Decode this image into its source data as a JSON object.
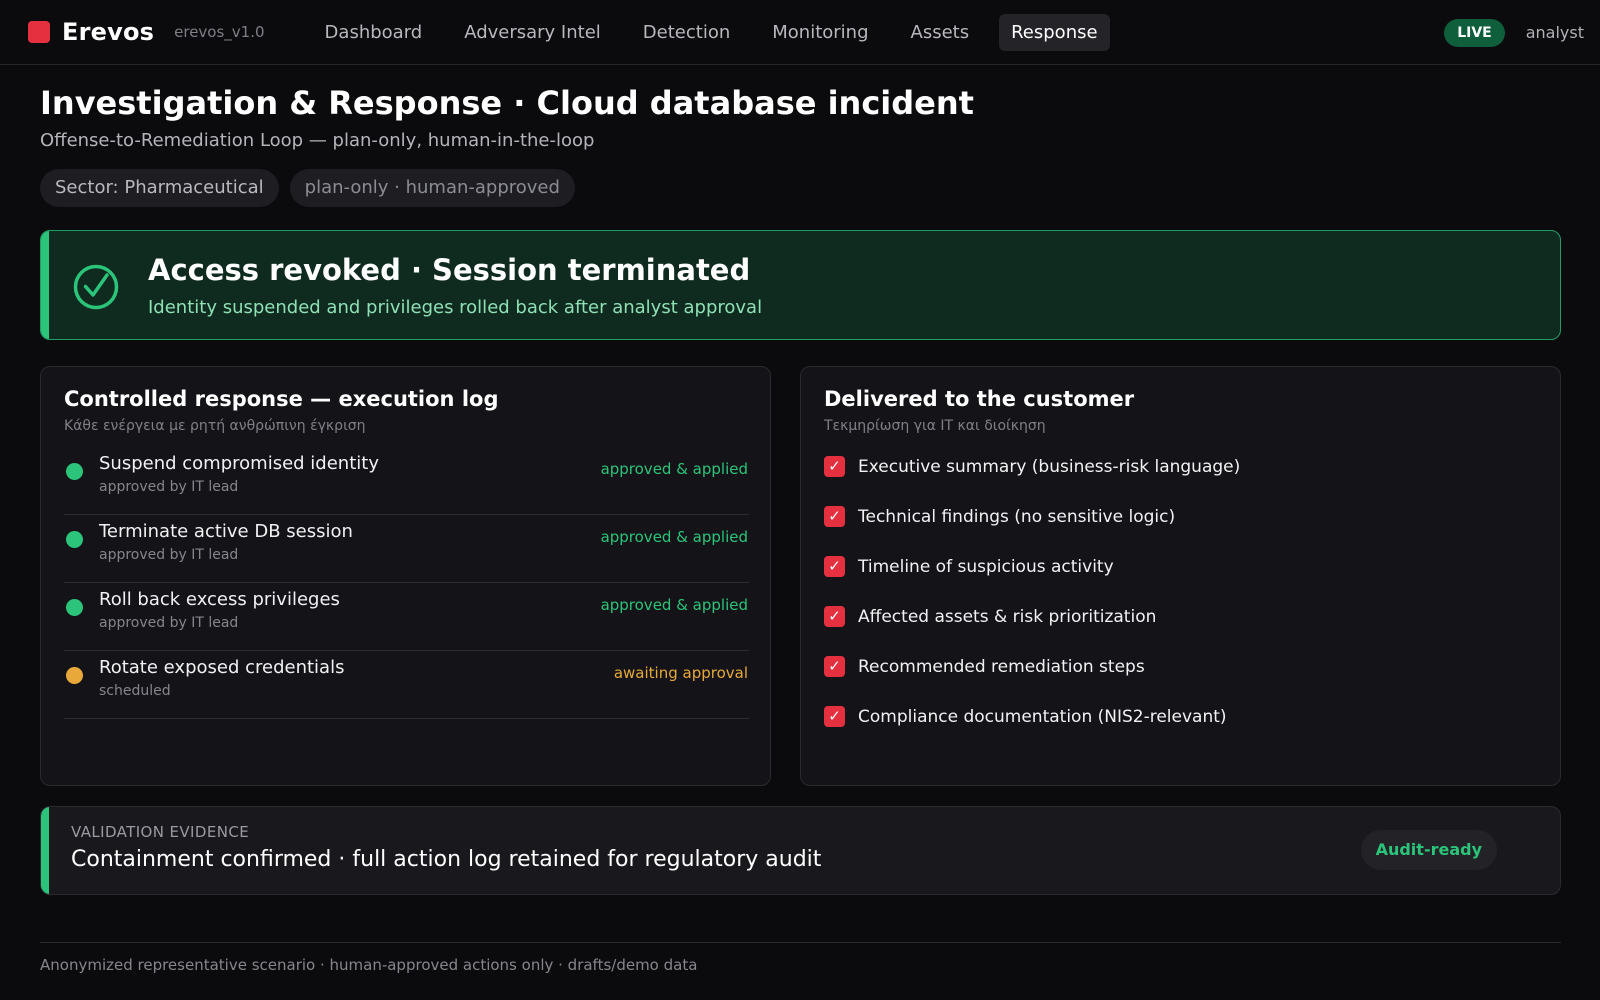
{
  "app": {
    "name": "Erevos",
    "version": "erevos_v1.0",
    "brand_color": "#e5303f"
  },
  "nav": {
    "items": [
      {
        "label": "Dashboard",
        "active": false
      },
      {
        "label": "Adversary Intel",
        "active": false
      },
      {
        "label": "Detection",
        "active": false
      },
      {
        "label": "Monitoring",
        "active": false
      },
      {
        "label": "Assets",
        "active": false
      },
      {
        "label": "Response",
        "active": true
      }
    ]
  },
  "status": {
    "live_label": "LIVE",
    "user": "analyst"
  },
  "header": {
    "title": "Investigation & Response · Cloud database incident",
    "subtitle": "Offense-to-Remediation Loop — plan-only, human-in-the-loop",
    "chips": [
      "Sector: Pharmaceutical",
      "plan-only · human-approved"
    ]
  },
  "banner": {
    "icon": "check-circle-icon",
    "title": "Access revoked · Session terminated",
    "subtitle": "Identity suspended and privileges rolled back after analyst approval",
    "color": "#2bc47a"
  },
  "execution_log": {
    "title": "Controlled response — execution log",
    "subtitle": "Κάθε ενέργεια με ρητή ανθρώπινη έγκριση",
    "items": [
      {
        "name": "Suspend compromised identity",
        "meta": "approved by IT lead",
        "status": "approved & applied",
        "state": "done"
      },
      {
        "name": "Terminate active DB session",
        "meta": "approved by IT lead",
        "status": "approved & applied",
        "state": "done"
      },
      {
        "name": "Roll back excess privileges",
        "meta": "approved by IT lead",
        "status": "approved & applied",
        "state": "done"
      },
      {
        "name": "Rotate exposed credentials",
        "meta": "scheduled",
        "status": "awaiting approval",
        "state": "pending"
      }
    ],
    "colors": {
      "done": "#2bc47a",
      "pending": "#e8a93a"
    }
  },
  "deliverables": {
    "title": "Delivered to the customer",
    "subtitle": "Τεκμηρίωση για IT και διοίκηση",
    "items": [
      "Executive summary (business-risk language)",
      "Technical findings (no sensitive logic)",
      "Timeline of suspicious activity",
      "Affected assets & risk prioritization",
      "Recommended remediation steps",
      "Compliance documentation (NIS2-relevant)"
    ]
  },
  "validation": {
    "label": "VALIDATION EVIDENCE",
    "text": "Containment confirmed · full action log retained for regulatory audit",
    "badge": "Audit-ready"
  },
  "footer": {
    "text": "Anonymized representative scenario · human-approved actions only · drafts/demo data"
  }
}
